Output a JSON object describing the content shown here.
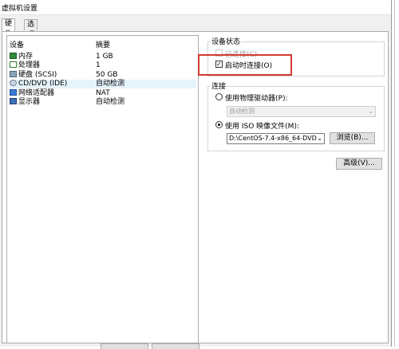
{
  "window": {
    "title": "虚拟机设置"
  },
  "tabs": [
    {
      "label": "硬件",
      "active": true
    },
    {
      "label": "选项",
      "active": false
    }
  ],
  "device_table": {
    "headers": [
      "设备",
      "摘要"
    ],
    "rows": [
      {
        "icon": "memory-icon",
        "device": "内存",
        "summary": "1 GB",
        "selected": false
      },
      {
        "icon": "processor-icon",
        "device": "处理器",
        "summary": "1",
        "selected": false
      },
      {
        "icon": "hard-disk-icon",
        "device": "硬盘 (SCSI)",
        "summary": "50 GB",
        "selected": false
      },
      {
        "icon": "cd-dvd-icon",
        "device": "CD/DVD (IDE)",
        "summary": "自动检测",
        "selected": true
      },
      {
        "icon": "network-adapter-icon",
        "device": "网络适配器",
        "summary": "NAT",
        "selected": false
      },
      {
        "icon": "display-icon",
        "device": "显示器",
        "summary": "自动检测",
        "selected": false
      }
    ]
  },
  "device_status": {
    "title": "设备状态",
    "connected_label": "已连接(C)",
    "connected_checked": false,
    "connect_on_startup_label": "启动时连接(O)",
    "connect_on_startup_checked": true
  },
  "connection": {
    "title": "连接",
    "physical_drive_label": "使用物理驱动器(P):",
    "physical_drive_value": "自动检测",
    "iso_label": "使用 ISO 映像文件(M):",
    "iso_path": "D:\\CentOS-7.4-x86_64-DVD",
    "selected": "iso",
    "browse_label": "浏览(B)...",
    "advanced_label": "高级(V)..."
  },
  "colors": {
    "highlight_box": "#d43a2f",
    "selected_row": "#e5f3fb"
  }
}
